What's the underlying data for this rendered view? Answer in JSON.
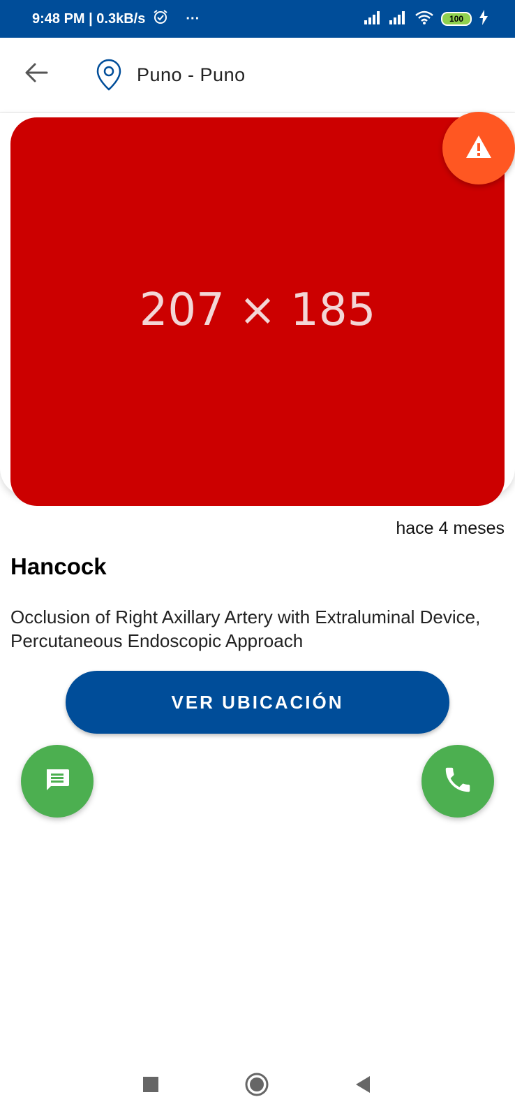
{
  "status_bar": {
    "time_speed": "9:48 PM | 0.3kB/s",
    "more": "···",
    "battery": "100"
  },
  "header": {
    "location": "Puno - Puno"
  },
  "image": {
    "placeholder_text": "207 × 185",
    "background_color": "#cc0000"
  },
  "post": {
    "time_ago": "hace 4 meses",
    "title": "Hancock",
    "description": "Occlusion of Right Axillary Artery with Extraluminal Device, Percutaneous Endoscopic Approach"
  },
  "actions": {
    "view_location_label": "VER UBICACIÓN"
  },
  "colors": {
    "primary": "#004d99",
    "warning": "#ff5722",
    "fab_green": "#4caf50"
  },
  "icons": {
    "back": "arrow-back-icon",
    "location": "location-pin-icon",
    "warning": "warning-triangle-icon",
    "chat": "chat-bubble-icon",
    "call": "phone-icon"
  }
}
